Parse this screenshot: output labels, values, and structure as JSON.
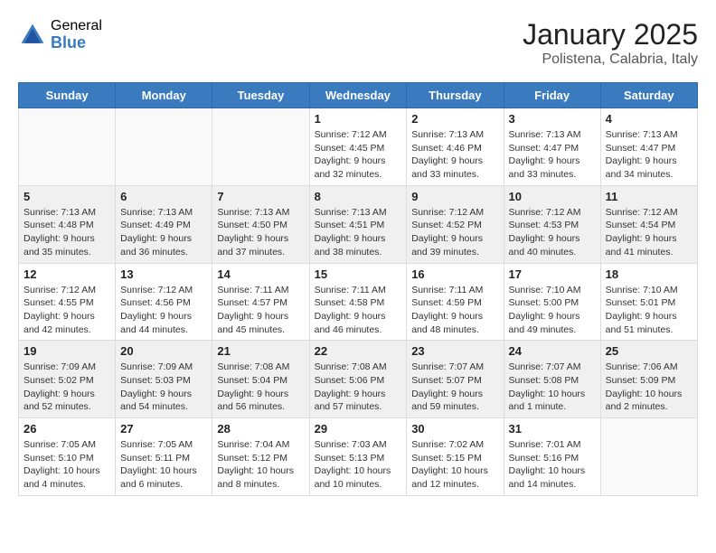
{
  "header": {
    "logo_general": "General",
    "logo_blue": "Blue",
    "month_year": "January 2025",
    "location": "Polistena, Calabria, Italy"
  },
  "weekdays": [
    "Sunday",
    "Monday",
    "Tuesday",
    "Wednesday",
    "Thursday",
    "Friday",
    "Saturday"
  ],
  "weeks": [
    {
      "shaded": false,
      "days": [
        {
          "num": "",
          "info": ""
        },
        {
          "num": "",
          "info": ""
        },
        {
          "num": "",
          "info": ""
        },
        {
          "num": "1",
          "info": "Sunrise: 7:12 AM\nSunset: 4:45 PM\nDaylight: 9 hours and 32 minutes."
        },
        {
          "num": "2",
          "info": "Sunrise: 7:13 AM\nSunset: 4:46 PM\nDaylight: 9 hours and 33 minutes."
        },
        {
          "num": "3",
          "info": "Sunrise: 7:13 AM\nSunset: 4:47 PM\nDaylight: 9 hours and 33 minutes."
        },
        {
          "num": "4",
          "info": "Sunrise: 7:13 AM\nSunset: 4:47 PM\nDaylight: 9 hours and 34 minutes."
        }
      ]
    },
    {
      "shaded": true,
      "days": [
        {
          "num": "5",
          "info": "Sunrise: 7:13 AM\nSunset: 4:48 PM\nDaylight: 9 hours and 35 minutes."
        },
        {
          "num": "6",
          "info": "Sunrise: 7:13 AM\nSunset: 4:49 PM\nDaylight: 9 hours and 36 minutes."
        },
        {
          "num": "7",
          "info": "Sunrise: 7:13 AM\nSunset: 4:50 PM\nDaylight: 9 hours and 37 minutes."
        },
        {
          "num": "8",
          "info": "Sunrise: 7:13 AM\nSunset: 4:51 PM\nDaylight: 9 hours and 38 minutes."
        },
        {
          "num": "9",
          "info": "Sunrise: 7:12 AM\nSunset: 4:52 PM\nDaylight: 9 hours and 39 minutes."
        },
        {
          "num": "10",
          "info": "Sunrise: 7:12 AM\nSunset: 4:53 PM\nDaylight: 9 hours and 40 minutes."
        },
        {
          "num": "11",
          "info": "Sunrise: 7:12 AM\nSunset: 4:54 PM\nDaylight: 9 hours and 41 minutes."
        }
      ]
    },
    {
      "shaded": false,
      "days": [
        {
          "num": "12",
          "info": "Sunrise: 7:12 AM\nSunset: 4:55 PM\nDaylight: 9 hours and 42 minutes."
        },
        {
          "num": "13",
          "info": "Sunrise: 7:12 AM\nSunset: 4:56 PM\nDaylight: 9 hours and 44 minutes."
        },
        {
          "num": "14",
          "info": "Sunrise: 7:11 AM\nSunset: 4:57 PM\nDaylight: 9 hours and 45 minutes."
        },
        {
          "num": "15",
          "info": "Sunrise: 7:11 AM\nSunset: 4:58 PM\nDaylight: 9 hours and 46 minutes."
        },
        {
          "num": "16",
          "info": "Sunrise: 7:11 AM\nSunset: 4:59 PM\nDaylight: 9 hours and 48 minutes."
        },
        {
          "num": "17",
          "info": "Sunrise: 7:10 AM\nSunset: 5:00 PM\nDaylight: 9 hours and 49 minutes."
        },
        {
          "num": "18",
          "info": "Sunrise: 7:10 AM\nSunset: 5:01 PM\nDaylight: 9 hours and 51 minutes."
        }
      ]
    },
    {
      "shaded": true,
      "days": [
        {
          "num": "19",
          "info": "Sunrise: 7:09 AM\nSunset: 5:02 PM\nDaylight: 9 hours and 52 minutes."
        },
        {
          "num": "20",
          "info": "Sunrise: 7:09 AM\nSunset: 5:03 PM\nDaylight: 9 hours and 54 minutes."
        },
        {
          "num": "21",
          "info": "Sunrise: 7:08 AM\nSunset: 5:04 PM\nDaylight: 9 hours and 56 minutes."
        },
        {
          "num": "22",
          "info": "Sunrise: 7:08 AM\nSunset: 5:06 PM\nDaylight: 9 hours and 57 minutes."
        },
        {
          "num": "23",
          "info": "Sunrise: 7:07 AM\nSunset: 5:07 PM\nDaylight: 9 hours and 59 minutes."
        },
        {
          "num": "24",
          "info": "Sunrise: 7:07 AM\nSunset: 5:08 PM\nDaylight: 10 hours and 1 minute."
        },
        {
          "num": "25",
          "info": "Sunrise: 7:06 AM\nSunset: 5:09 PM\nDaylight: 10 hours and 2 minutes."
        }
      ]
    },
    {
      "shaded": false,
      "days": [
        {
          "num": "26",
          "info": "Sunrise: 7:05 AM\nSunset: 5:10 PM\nDaylight: 10 hours and 4 minutes."
        },
        {
          "num": "27",
          "info": "Sunrise: 7:05 AM\nSunset: 5:11 PM\nDaylight: 10 hours and 6 minutes."
        },
        {
          "num": "28",
          "info": "Sunrise: 7:04 AM\nSunset: 5:12 PM\nDaylight: 10 hours and 8 minutes."
        },
        {
          "num": "29",
          "info": "Sunrise: 7:03 AM\nSunset: 5:13 PM\nDaylight: 10 hours and 10 minutes."
        },
        {
          "num": "30",
          "info": "Sunrise: 7:02 AM\nSunset: 5:15 PM\nDaylight: 10 hours and 12 minutes."
        },
        {
          "num": "31",
          "info": "Sunrise: 7:01 AM\nSunset: 5:16 PM\nDaylight: 10 hours and 14 minutes."
        },
        {
          "num": "",
          "info": ""
        }
      ]
    }
  ]
}
